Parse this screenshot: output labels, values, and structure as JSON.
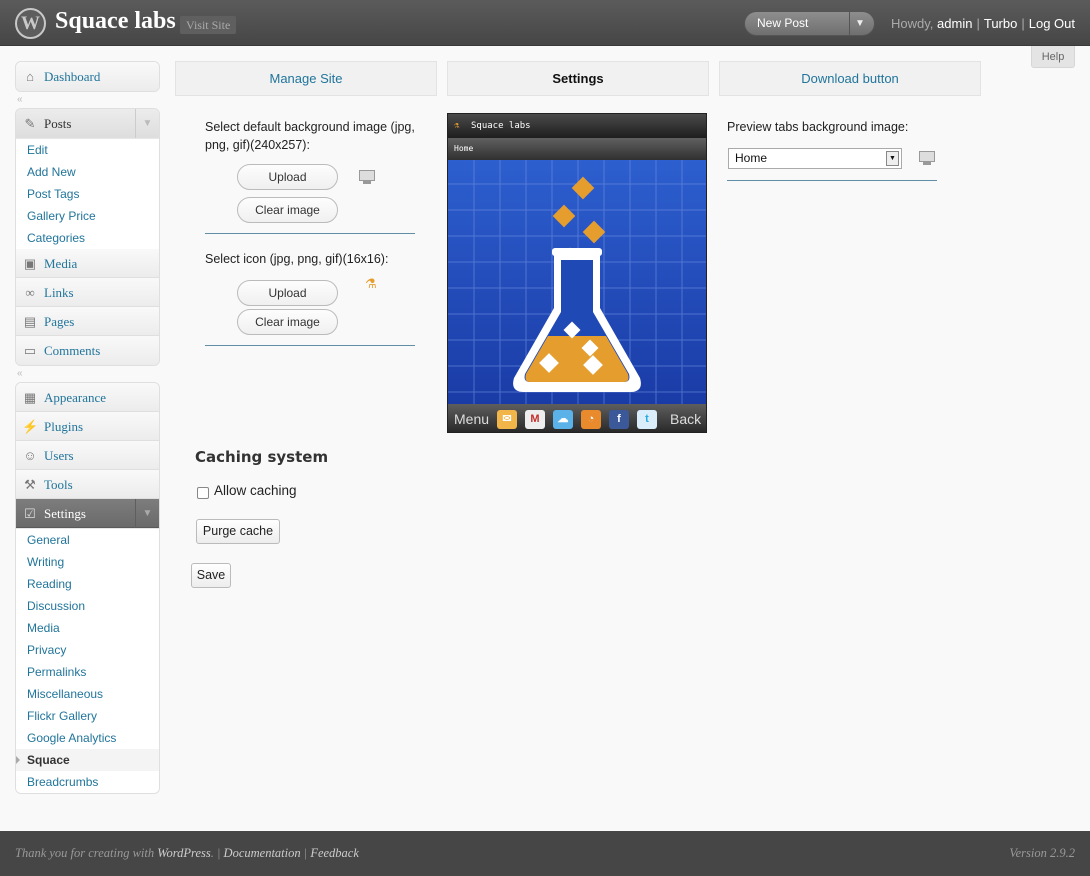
{
  "header": {
    "logo_glyph": "W",
    "site_title": "Squace labs",
    "visit_site": "Visit Site",
    "new_post": "New Post",
    "howdy": "Howdy,",
    "username": "admin",
    "turbo": "Turbo",
    "logout": "Log Out",
    "help": "Help"
  },
  "sidebar": {
    "dashboard": "Dashboard",
    "posts": "Posts",
    "posts_sub": [
      "Edit",
      "Add New",
      "Post Tags",
      "Gallery Price",
      "Categories"
    ],
    "media": "Media",
    "links": "Links",
    "pages": "Pages",
    "comments": "Comments",
    "appearance": "Appearance",
    "plugins": "Plugins",
    "users": "Users",
    "tools": "Tools",
    "settings": "Settings",
    "settings_sub": [
      "General",
      "Writing",
      "Reading",
      "Discussion",
      "Media",
      "Privacy",
      "Permalinks",
      "Miscellaneous",
      "Flickr Gallery",
      "Google Analytics",
      "Squace",
      "Breadcrumbs"
    ]
  },
  "tabs": {
    "manage_site": "Manage Site",
    "settings": "Settings",
    "download_button": "Download button"
  },
  "bg_image": {
    "label": "Select default background image (jpg, png, gif)(240x257):",
    "upload": "Upload",
    "clear": "Clear image"
  },
  "icon_image": {
    "label": "Select icon (jpg, png, gif)(16x16):",
    "upload": "Upload",
    "clear": "Clear image"
  },
  "phone": {
    "title": "Squace labs",
    "tab": "Home",
    "menu": "Menu",
    "back": "Back",
    "background_color": "#1f49b5",
    "flask_color": "#e59d2d"
  },
  "preview_tabs": {
    "label": "Preview tabs background image:",
    "selected": "Home"
  },
  "caching": {
    "title": "Caching system",
    "allow_label": "Allow caching",
    "purge": "Purge cache",
    "save": "Save"
  },
  "footer": {
    "thanks": "Thank you for creating with",
    "wordpress": "WordPress",
    "documentation": "Documentation",
    "feedback": "Feedback",
    "version": "Version 2.9.2"
  }
}
